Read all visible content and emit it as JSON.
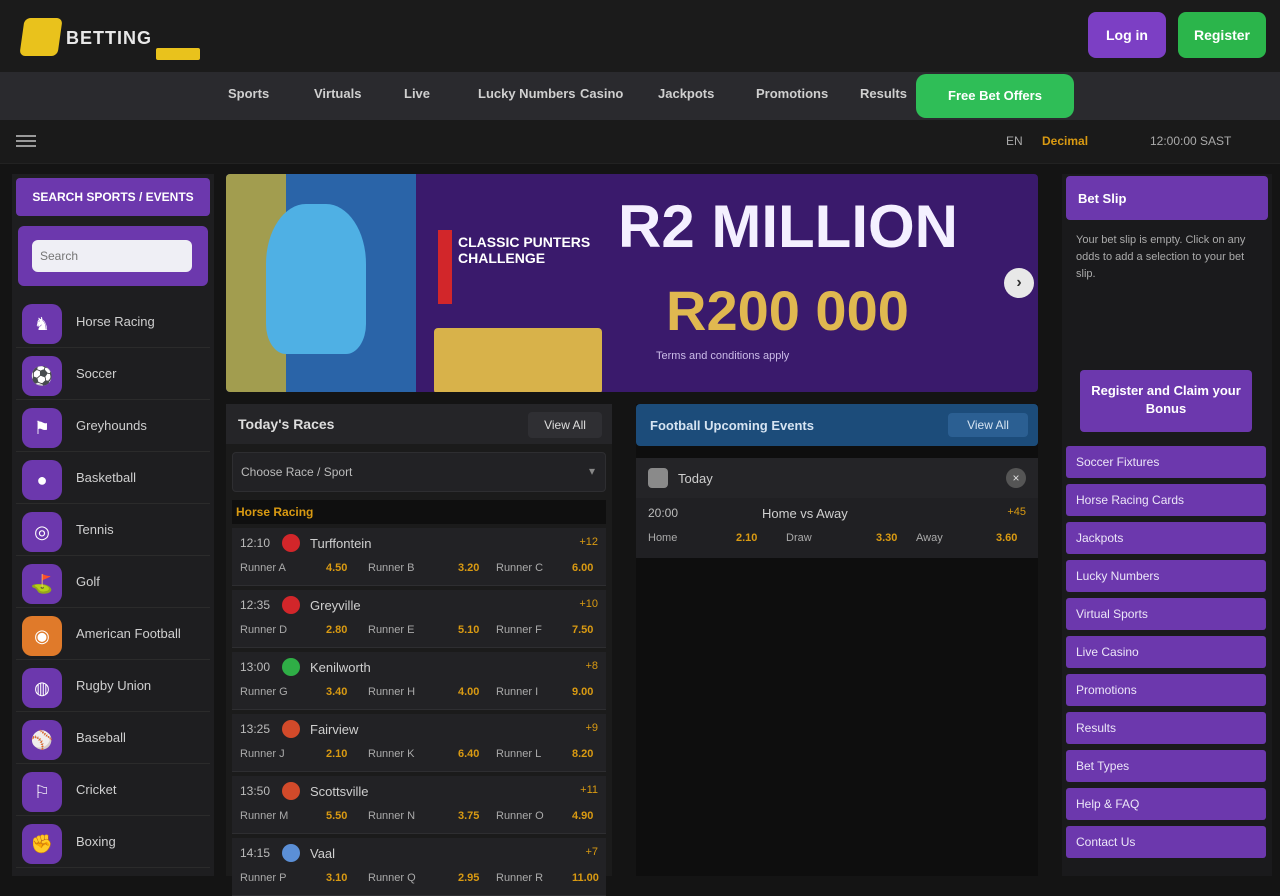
{
  "header": {
    "logo_text": "BETTING",
    "login_label": "Log in",
    "register_label": "Register"
  },
  "nav": {
    "items": [
      "Sports",
      "Virtuals",
      "Live",
      "Lucky Numbers",
      "Casino",
      "Jackpots",
      "Promotions",
      "Results"
    ],
    "promo_label": "Free Bet Offers"
  },
  "subbar": {
    "language": "EN",
    "odds_format": "Decimal",
    "clock": "12:00:00 SAST"
  },
  "sidebar": {
    "heading": "SEARCH SPORTS / EVENTS",
    "search_placeholder": "Search",
    "sports": [
      "Horse Racing",
      "Soccer",
      "Greyhounds",
      "Basketball",
      "Tennis",
      "Golf",
      "American Football",
      "Rugby Union",
      "Baseball",
      "Cricket",
      "Boxing"
    ]
  },
  "banner": {
    "poster_text": "CLASSIC PUNTERS CHALLENGE",
    "headline": "R2 MILLION",
    "amount": "R200 000",
    "note": "Terms and conditions apply"
  },
  "today": {
    "title": "Today's Races",
    "view_all": "View All",
    "selector": "Choose Race / Sport",
    "group_label": "Horse Racing",
    "matches": [
      {
        "time": "12:10",
        "flag": "#d2262a",
        "name": "Turffontein",
        "more": "+12",
        "sels": [
          [
            "Runner A",
            "4.50"
          ],
          [
            "Runner B",
            "3.20"
          ],
          [
            "Runner C",
            "6.00"
          ]
        ]
      },
      {
        "time": "12:35",
        "flag": "#d2262a",
        "name": "Greyville",
        "more": "+10",
        "sels": [
          [
            "Runner D",
            "2.80"
          ],
          [
            "Runner E",
            "5.10"
          ],
          [
            "Runner F",
            "7.50"
          ]
        ]
      },
      {
        "time": "13:00",
        "flag": "#2fae46",
        "name": "Kenilworth",
        "more": "+8",
        "sels": [
          [
            "Runner G",
            "3.40"
          ],
          [
            "Runner H",
            "4.00"
          ],
          [
            "Runner I",
            "9.00"
          ]
        ]
      },
      {
        "time": "13:25",
        "flag": "#d24a2a",
        "name": "Fairview",
        "more": "+9",
        "sels": [
          [
            "Runner J",
            "2.10"
          ],
          [
            "Runner K",
            "6.40"
          ],
          [
            "Runner L",
            "8.20"
          ]
        ]
      },
      {
        "time": "13:50",
        "flag": "#d24a2a",
        "name": "Scottsville",
        "more": "+11",
        "sels": [
          [
            "Runner M",
            "5.50"
          ],
          [
            "Runner N",
            "3.75"
          ],
          [
            "Runner O",
            "4.90"
          ]
        ]
      },
      {
        "time": "14:15",
        "flag": "#5b8fd6",
        "name": "Vaal",
        "more": "+7",
        "sels": [
          [
            "Runner P",
            "3.10"
          ],
          [
            "Runner Q",
            "2.95"
          ],
          [
            "Runner R",
            "11.00"
          ]
        ]
      }
    ]
  },
  "live": {
    "title": "Football Upcoming Events",
    "view_all": "View All",
    "date_label": "Today",
    "close": "×",
    "event": {
      "time": "20:00",
      "name": "Home vs Away",
      "more": "+45",
      "sels": [
        [
          "Home",
          "2.10"
        ],
        [
          "Draw",
          "3.30"
        ],
        [
          "Away",
          "3.60"
        ]
      ]
    }
  },
  "rightbar": {
    "heading": "Bet Slip",
    "text": "Your bet slip is empty. Click on any odds to add a selection to your bet slip.",
    "cta": "Register and Claim your Bonus",
    "links": [
      "Soccer Fixtures",
      "Horse Racing Cards",
      "Jackpots",
      "Lucky Numbers",
      "Virtual Sports",
      "Live Casino",
      "Promotions",
      "Results",
      "Bet Types",
      "Help & FAQ",
      "Contact Us"
    ]
  }
}
